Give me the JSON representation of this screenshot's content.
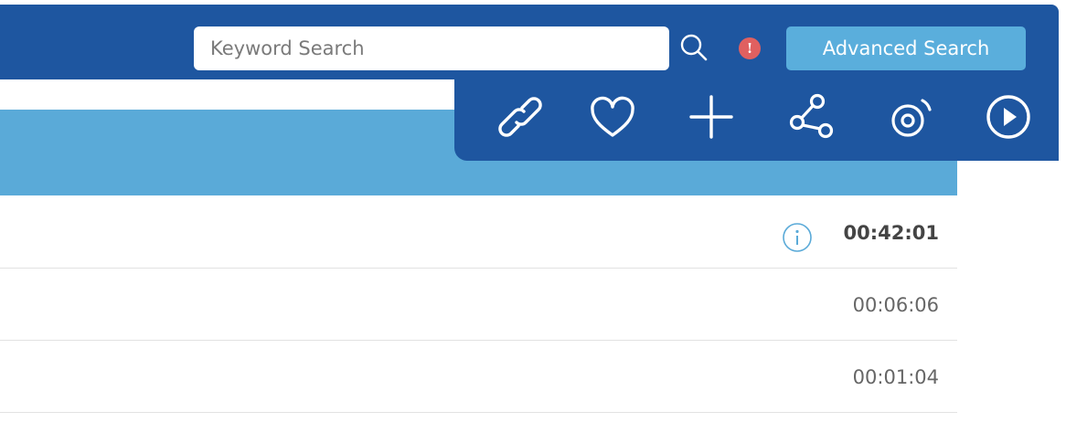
{
  "search": {
    "placeholder": "Keyword Search",
    "value": ""
  },
  "header": {
    "advanced_search_label": "Advanced Search",
    "alert_glyph": "!"
  },
  "actions": [
    {
      "icon": "link-icon"
    },
    {
      "icon": "heart-icon"
    },
    {
      "icon": "plus-icon"
    },
    {
      "icon": "share-icon"
    },
    {
      "icon": "radio-broadcast-icon"
    },
    {
      "icon": "play-icon"
    }
  ],
  "rows": [
    {
      "duration": "00:42:01",
      "has_info": true,
      "emphasized": true
    },
    {
      "duration": "00:06:06",
      "has_info": false,
      "emphasized": false
    },
    {
      "duration": "00:01:04",
      "has_info": false,
      "emphasized": false
    }
  ],
  "colors": {
    "header_bg": "#1e56a0",
    "list_header_bg": "#5aaad8",
    "button_bg": "#5aaedc",
    "alert": "#e06060",
    "info_icon": "#5aaad8"
  }
}
